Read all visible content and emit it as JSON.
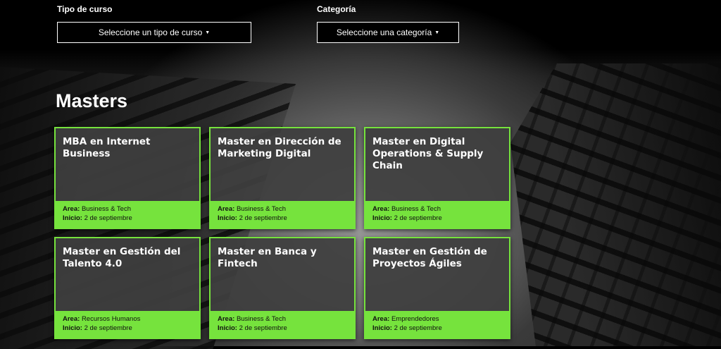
{
  "filters": {
    "course_type": {
      "label": "Tipo de curso",
      "selected": "Seleccione un tipo de curso"
    },
    "category": {
      "label": "Categoría",
      "selected": "Seleccione una categoría"
    }
  },
  "section": {
    "title": "Masters"
  },
  "labels": {
    "area": "Area:",
    "start": "Inicio:"
  },
  "colors": {
    "accent": "#76e33d",
    "card_bg": "#3e3e3e",
    "page_bg": "#000000"
  },
  "icons": {
    "dropdown": "caret-down-icon"
  },
  "courses": [
    {
      "title": "MBA en Internet Business",
      "area": "Business & Tech",
      "start": "2 de septiembre"
    },
    {
      "title": "Master en Dirección de Marketing Digital",
      "area": "Business & Tech",
      "start": "2 de septiembre"
    },
    {
      "title": "Master en Digital Operations & Supply Chain",
      "area": "Business & Tech",
      "start": "2 de septiembre"
    },
    {
      "title": "Master en Gestión del Talento 4.0",
      "area": "Recursos Humanos",
      "start": "2 de septiembre"
    },
    {
      "title": "Master en Banca y Fintech",
      "area": "Business & Tech",
      "start": "2 de septiembre"
    },
    {
      "title": "Master en Gestión de Proyectos Ágiles",
      "area": "Emprendedores",
      "start": "2 de septiembre"
    }
  ]
}
